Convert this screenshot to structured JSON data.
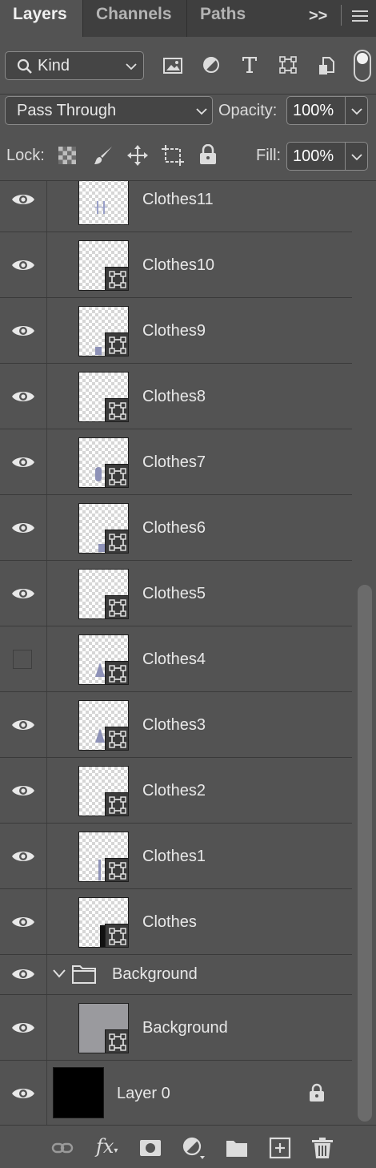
{
  "tabs": {
    "layers": "Layers",
    "channels": "Channels",
    "paths": "Paths",
    "overflow_label": ">>"
  },
  "filter": {
    "kind_label": "Kind",
    "icons": [
      "image-filter-icon",
      "adjustment-filter-icon",
      "type-filter-icon",
      "shape-filter-icon",
      "smart-object-filter-icon",
      "filter-toggle-icon"
    ]
  },
  "blend": {
    "mode": "Pass Through",
    "opacity_label": "Opacity:",
    "opacity_value": "100%"
  },
  "lock": {
    "label": "Lock:",
    "fill_label": "Fill:",
    "fill_value": "100%",
    "icons": [
      "lock-transparent-icon",
      "lock-image-icon",
      "lock-position-icon",
      "lock-artboard-icon",
      "lock-all-icon"
    ]
  },
  "layers": [
    {
      "name": "Clothes11",
      "visible": true
    },
    {
      "name": "Clothes10",
      "visible": true
    },
    {
      "name": "Clothes9",
      "visible": true
    },
    {
      "name": "Clothes8",
      "visible": true
    },
    {
      "name": "Clothes7",
      "visible": true
    },
    {
      "name": "Clothes6",
      "visible": true
    },
    {
      "name": "Clothes5",
      "visible": true
    },
    {
      "name": "Clothes4",
      "visible": false
    },
    {
      "name": "Clothes3",
      "visible": true
    },
    {
      "name": "Clothes2",
      "visible": true
    },
    {
      "name": "Clothes1",
      "visible": true
    },
    {
      "name": "Clothes",
      "visible": true
    }
  ],
  "group": {
    "name": "Background",
    "expanded": true
  },
  "group_child": {
    "name": "Background",
    "visible": true
  },
  "base_layer": {
    "name": "Layer 0",
    "visible": true,
    "locked": true
  },
  "footer_icons": [
    "link-layers-icon",
    "fx-icon",
    "add-mask-icon",
    "adjustment-layer-icon",
    "new-group-icon",
    "new-layer-icon",
    "delete-icon"
  ],
  "colors": {
    "panel_bg": "#535353",
    "tab_bar_bg": "#3f3f3f",
    "thumb_accent": "#8e92b8"
  }
}
